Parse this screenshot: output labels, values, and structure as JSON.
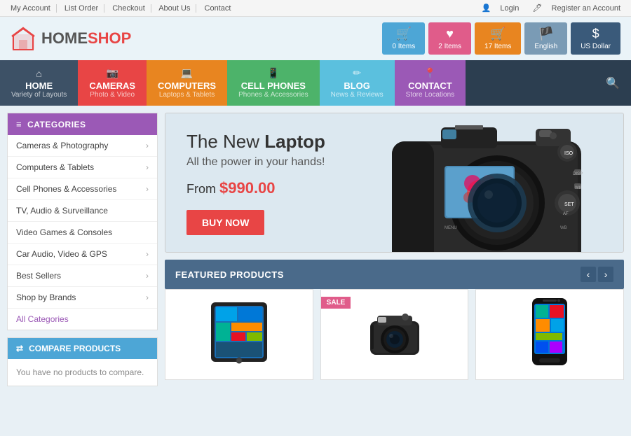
{
  "topbar": {
    "links": [
      "My Account",
      "List Order",
      "Checkout",
      "About Us",
      "Contact"
    ],
    "login": "Login",
    "create_account": "Register an Account"
  },
  "logo": {
    "home": "HOME",
    "shop": "SHOP"
  },
  "header_icons": [
    {
      "label": "0 Items",
      "icon": "🛒",
      "class": "hib-blue"
    },
    {
      "label": "2 Items",
      "icon": "♥",
      "class": "hib-pink"
    },
    {
      "label": "17 Items",
      "icon": "🛒",
      "class": "hib-orange"
    },
    {
      "label": "English",
      "icon": "🇬🇧",
      "class": "hib-gray"
    },
    {
      "label": "US Dollar",
      "icon": "$",
      "class": "hib-dark"
    }
  ],
  "nav": {
    "items": [
      {
        "main": "HOME",
        "sub": "Variety of Layouts",
        "icon": "⌂",
        "class": "nav-home"
      },
      {
        "main": "CAMERAS",
        "sub": "Photo & Video",
        "icon": "📷",
        "class": "nav-cameras"
      },
      {
        "main": "COMPUTERS",
        "sub": "Laptops & Tablets",
        "icon": "💻",
        "class": "nav-computers"
      },
      {
        "main": "CELL PHONES",
        "sub": "Phones & Accessories",
        "icon": "📱",
        "class": "nav-cellphones"
      },
      {
        "main": "BLOG",
        "sub": "News & Reviews",
        "icon": "✏",
        "class": "nav-blog"
      },
      {
        "main": "CONTACT",
        "sub": "Store Locations",
        "icon": "📍",
        "class": "nav-contact"
      }
    ]
  },
  "sidebar": {
    "categories_header": "CATEGORIES",
    "items": [
      {
        "label": "Cameras & Photography",
        "has_sub": true
      },
      {
        "label": "Computers & Tablets",
        "has_sub": true
      },
      {
        "label": "Cell Phones & Accessories",
        "has_sub": true
      },
      {
        "label": "TV, Audio & Surveillance",
        "has_sub": false
      },
      {
        "label": "Video Games & Consoles",
        "has_sub": false
      },
      {
        "label": "Car Audio, Video & GPS",
        "has_sub": true
      },
      {
        "label": "Best Sellers",
        "has_sub": true
      },
      {
        "label": "Shop by Brands",
        "has_sub": true
      }
    ],
    "all_categories": "All Categories",
    "compare_header": "COMPARE PRODUCTS",
    "compare_text": "You have no products to compare."
  },
  "banner": {
    "title_start": "The New ",
    "title_bold": "Laptop",
    "subtitle": "All the power in your hands!",
    "price_label": "From ",
    "price": "$990.00",
    "buy_label": "BUY NOW"
  },
  "featured": {
    "header": "FEATURED PRODUCTS"
  },
  "products": [
    {
      "name": "Tablet",
      "has_sale": false
    },
    {
      "name": "Camera",
      "has_sale": true
    },
    {
      "name": "Phone",
      "has_sale": false
    }
  ]
}
